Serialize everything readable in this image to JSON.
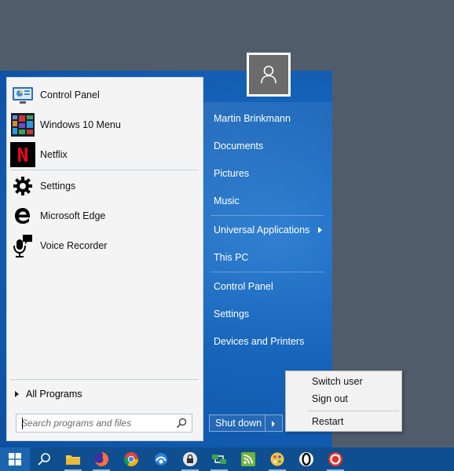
{
  "start_menu": {
    "programs": [
      {
        "label": "Control Panel",
        "icon": "control-panel-icon"
      },
      {
        "label": "Windows 10 Menu",
        "icon": "windows-10-menu-icon"
      },
      {
        "label": "Netflix",
        "icon": "netflix-icon"
      },
      {
        "label": "Settings",
        "icon": "settings-gear-icon"
      },
      {
        "label": "Microsoft Edge",
        "icon": "microsoft-edge-icon"
      },
      {
        "label": "Voice Recorder",
        "icon": "voice-recorder-icon"
      }
    ],
    "all_programs": "All Programs",
    "search": {
      "placeholder": "Search programs and files",
      "icon": "search-icon"
    },
    "user": {
      "icon": "user-avatar-icon"
    },
    "places": [
      {
        "label": "Martin Brinkmann"
      },
      {
        "label": "Documents"
      },
      {
        "label": "Pictures"
      },
      {
        "label": "Music"
      },
      {
        "label": "Universal Applications",
        "has_submenu": true
      },
      {
        "label": "This PC"
      },
      {
        "label": "Control Panel"
      },
      {
        "label": "Settings"
      },
      {
        "label": "Devices and Printers"
      }
    ],
    "shutdown": {
      "label": "Shut down"
    },
    "shutdown_menu": {
      "items": [
        "Switch user",
        "Sign out",
        "Restart"
      ]
    }
  },
  "taskbar": {
    "icons": [
      {
        "name": "start-button",
        "icon": "windows-logo-icon"
      },
      {
        "name": "search",
        "icon": "search-icon"
      },
      {
        "name": "file-explorer",
        "icon": "folder-icon"
      },
      {
        "name": "firefox",
        "icon": "firefox-icon"
      },
      {
        "name": "chrome",
        "icon": "chrome-icon"
      },
      {
        "name": "app-blue",
        "icon": "app-icon"
      },
      {
        "name": "keepass",
        "icon": "lock-icon"
      },
      {
        "name": "network-app",
        "icon": "network-icon"
      },
      {
        "name": "rss-reader",
        "icon": "rss-icon"
      },
      {
        "name": "paint-app",
        "icon": "paint-icon"
      },
      {
        "name": "opera",
        "icon": "opera-icon"
      },
      {
        "name": "vivaldi",
        "icon": "vivaldi-icon"
      }
    ]
  },
  "colors": {
    "desktop": "#515c6b",
    "menu_blue": "#1563b9",
    "taskbar": "#0f4f8f",
    "left_pane": "#f4f4f4"
  }
}
